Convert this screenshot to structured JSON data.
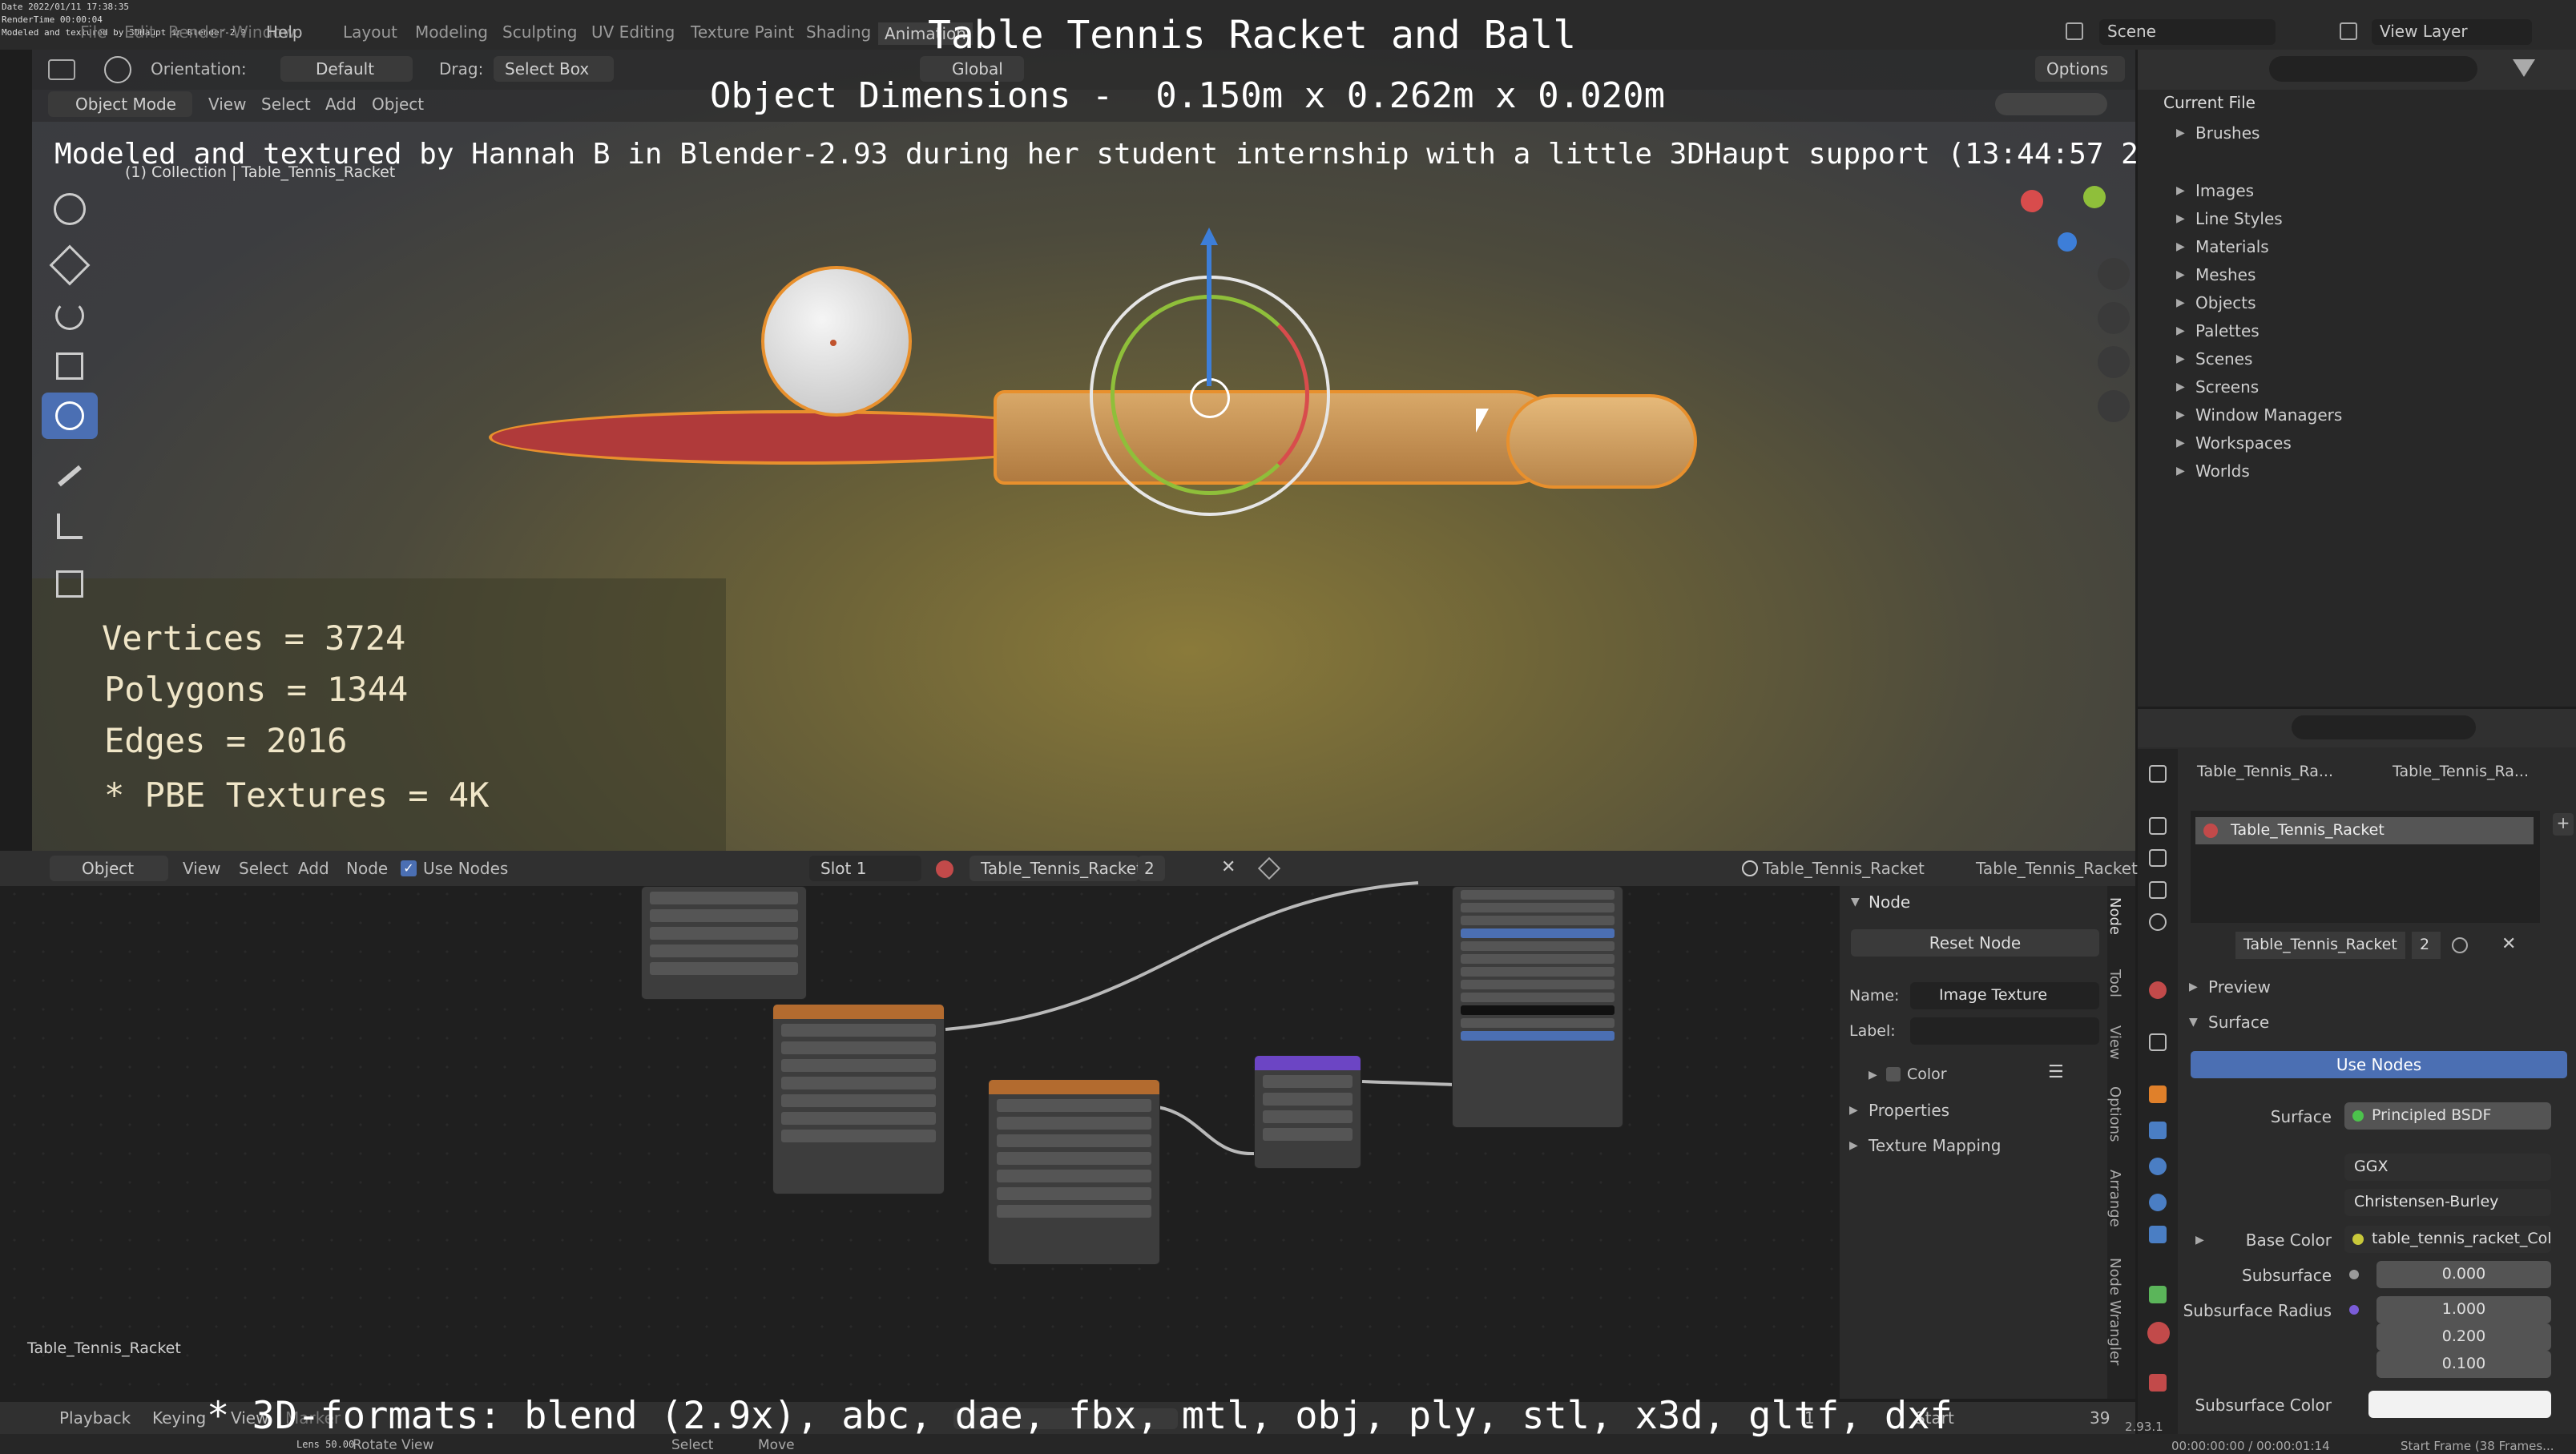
{
  "header": {
    "date": "Date 2022/01/11 17:38:35",
    "render_time": "RenderTime 00:00:04",
    "credit_small": "Modeled and textured by 3DHaupt in Blender-2.9",
    "menus": [
      "File",
      "Edit",
      "Render",
      "Window",
      "Help"
    ],
    "workspaces": [
      "Layout",
      "Modeling",
      "Sculpting",
      "UV Editing",
      "Texture Paint",
      "Shading",
      "Animation"
    ],
    "scene": "Scene",
    "view_layer": "View Layer"
  },
  "overlay": {
    "title": "Table Tennis Racket and Ball",
    "dimensions": "Object Dimensions -  0.150m x 0.262m x 0.020m",
    "credit": "Modeled and textured by Hannah B in Blender-2.93 during her student internship with a little 3DHaupt support (13:44:57 26.11.21)",
    "stats": [
      "Vertices = 3724",
      "Polygons = 1344",
      "Edges = 2016",
      "* PBE Textures = 4K"
    ],
    "formats": "* 3D-formats: blend (2.9x), abc, dae, fbx, mtl, obj, ply, stl, x3d, gltf, dxf"
  },
  "viewport_header": {
    "orientation_label": "Orientation:",
    "orientation_value": "Default",
    "drag_label": "Drag:",
    "drag_value": "Select Box",
    "transform": "Global",
    "options": "Options",
    "mode": "Object Mode",
    "menus": [
      "View",
      "Select",
      "Add",
      "Object"
    ],
    "collection": "(1) Collection | Table_Tennis_Racket"
  },
  "outliner": {
    "root": "Current File",
    "items": [
      "Brushes",
      "Images",
      "Line Styles",
      "Materials",
      "Meshes",
      "Objects",
      "Palettes",
      "Scenes",
      "Screens",
      "Window Managers",
      "Workspaces",
      "Worlds"
    ]
  },
  "properties": {
    "breadcrumb_1": "Table_Tennis_Ra...",
    "breadcrumb_2": "Table_Tennis_Ra...",
    "slot_name": "Table_Tennis_Racket",
    "material_name": "Table_Tennis_Racket",
    "users": "2",
    "preview": "Preview",
    "surface": "Surface",
    "use_nodes": "Use Nodes",
    "surface_label": "Surface",
    "surface_value": "Principled BSDF",
    "distribution": "GGX",
    "subsurface_method": "Christensen-Burley",
    "base_color_label": "Base Color",
    "base_color_value": "table_tennis_racket_Col.j...",
    "subsurface_label": "Subsurface",
    "subsurface_value": "0.000",
    "subsurface_radius_label": "Subsurface Radius",
    "radius_values": [
      "1.000",
      "0.200",
      "0.100"
    ],
    "subsurface_color_label": "Subsurface Color"
  },
  "node_editor": {
    "mode": "Object",
    "menus": [
      "View",
      "Select",
      "Add",
      "Node"
    ],
    "use_nodes": "Use Nodes",
    "slot": "Slot 1",
    "material": "Table_Tennis_Racket",
    "users": "2",
    "object_crumb": "Table_Tennis_Racket",
    "material_crumb": "Table_Tennis_Racket",
    "footer_label": "Table_Tennis_Racket"
  },
  "node_panel": {
    "section": "Node",
    "reset": "Reset Node",
    "name_label": "Name:",
    "name_value": "Image Texture",
    "label_label": "Label:",
    "color": "Color",
    "properties": "Properties",
    "texture_mapping": "Texture Mapping",
    "tabs": [
      "Node",
      "Tool",
      "View",
      "Options",
      "Arrange",
      "Node Wrangler"
    ]
  },
  "timeline": {
    "playback": "Playback",
    "keying": "Keying",
    "view": "View",
    "marker": "Marker",
    "start": "Start",
    "start_value": "1",
    "end_value": "39",
    "select": "Select",
    "move": "Move",
    "rotate_view": "Rotate View",
    "frame_info": "Start Frame (38 Frames...",
    "version": "2.93.1",
    "time": "00:00:00:00 / 00:00:01:14",
    "lens_info": "Lens 50.00"
  }
}
